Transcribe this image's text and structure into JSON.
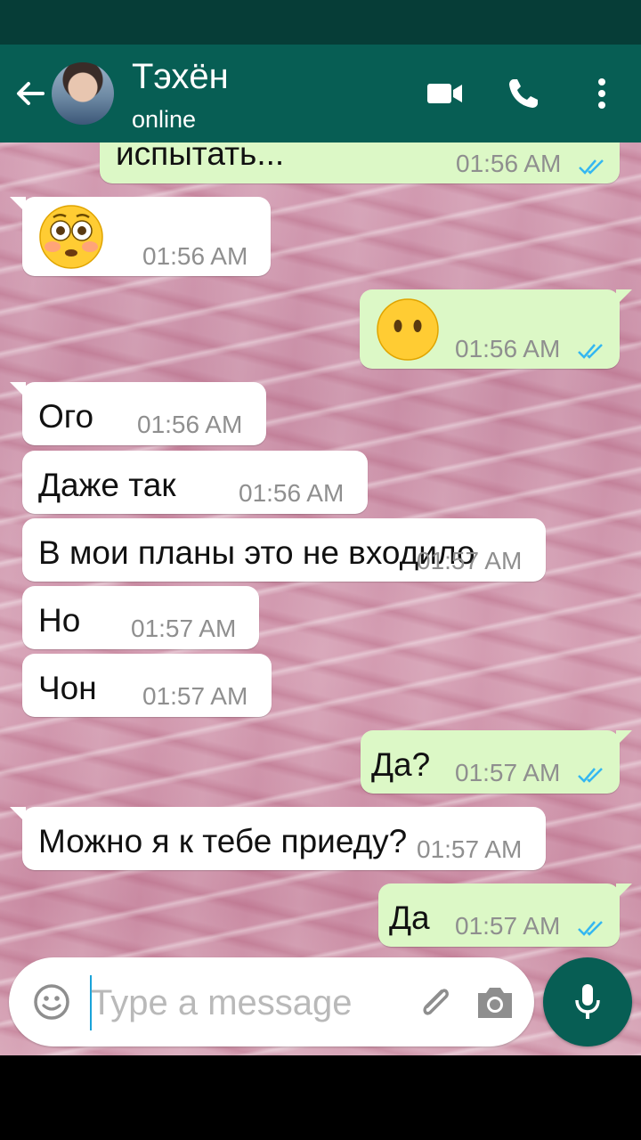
{
  "header": {
    "back_icon": "arrow-left-icon",
    "contact_name": "Тэхён",
    "contact_status": "online",
    "actions": [
      "video-call-icon",
      "phone-icon",
      "more-vert-icon"
    ]
  },
  "messages": [
    {
      "direction": "out",
      "text": "испытать...",
      "time": "01:56 AM",
      "status": "read"
    },
    {
      "direction": "in",
      "emoji": "flushed-face",
      "time": "01:56 AM"
    },
    {
      "direction": "out",
      "emoji": "face-without-mouth",
      "time": "01:56 AM",
      "status": "read"
    },
    {
      "direction": "in",
      "text": "Ого",
      "time": "01:56 AM"
    },
    {
      "direction": "in",
      "text": "Даже так",
      "time": "01:56 AM"
    },
    {
      "direction": "in",
      "text": "В мои планы это не входило",
      "time": "01:57 AM"
    },
    {
      "direction": "in",
      "text": "Но",
      "time": "01:57 AM"
    },
    {
      "direction": "in",
      "text": "Чон",
      "time": "01:57 AM"
    },
    {
      "direction": "out",
      "text": "Да?",
      "time": "01:57 AM",
      "status": "read"
    },
    {
      "direction": "in",
      "text": "Можно я к тебе приеду?",
      "time": "01:57 AM"
    },
    {
      "direction": "out",
      "text": "Да",
      "time": "01:57 AM",
      "status": "read"
    }
  ],
  "composer": {
    "placeholder": "Type a message",
    "emoji_icon": "smiley-icon",
    "attach_icon": "paperclip-icon",
    "camera_icon": "camera-icon",
    "mic_icon": "microphone-icon"
  },
  "colors": {
    "header": "#075e54",
    "status_bar": "#063d37",
    "outgoing_bubble": "#dcf8c6",
    "incoming_bubble": "#ffffff",
    "read_ticks": "#34b7f1",
    "timestamp": "#8f8f8f"
  }
}
